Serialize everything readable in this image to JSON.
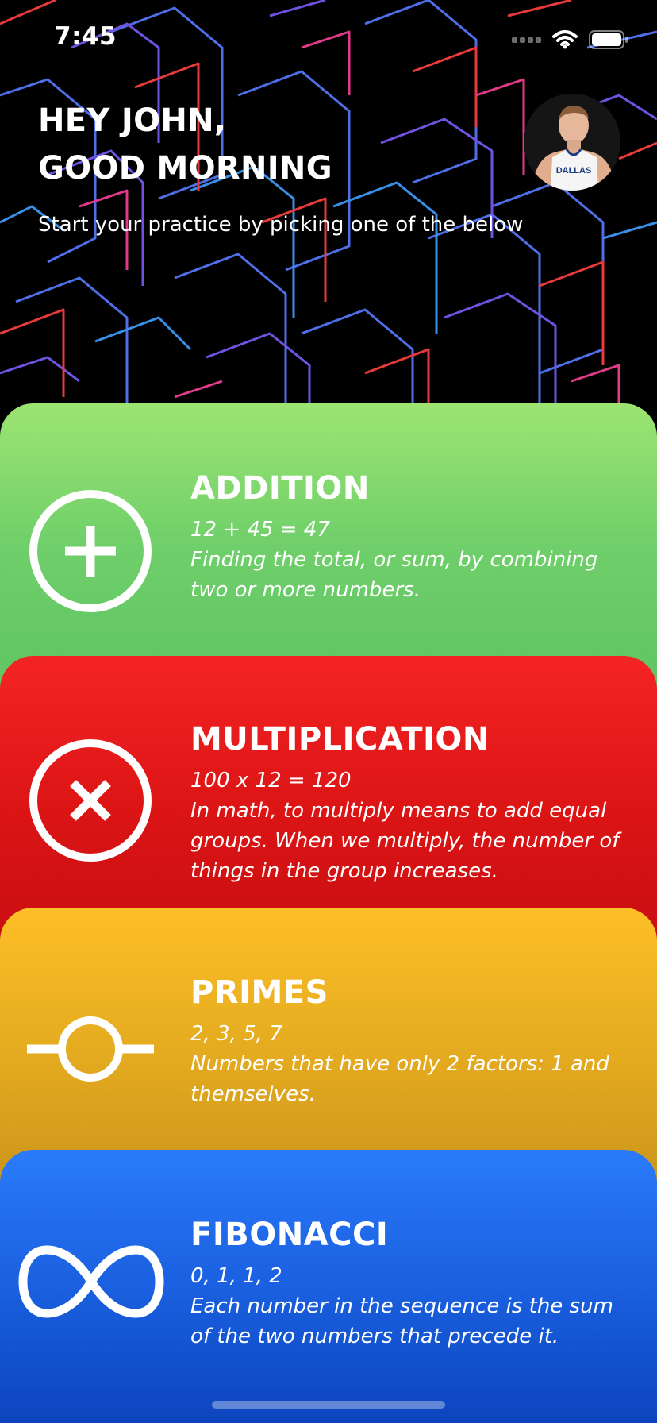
{
  "status_bar": {
    "time": "7:45"
  },
  "header": {
    "greeting_line1": "HEY JOHN,",
    "greeting_line2": "GOOD MORNING",
    "subtitle": "Start your practice by picking one of the below",
    "avatar_jersey_text": "DALLAS"
  },
  "cards": [
    {
      "title": "ADDITION",
      "example": "12 + 45 = 47",
      "description": "Finding the total, or sum, by combining two or more numbers.",
      "icon": "plus-circle-icon",
      "color": "#7fd86b"
    },
    {
      "title": "MULTIPLICATION",
      "example": "100 x 12 = 120",
      "description": "In math, to multiply means to add equal groups. When we multiply, the number of things in the group increases.",
      "icon": "times-circle-icon",
      "color": "#e01a1a"
    },
    {
      "title": "PRIMES",
      "example": "2, 3, 5, 7",
      "description": "Numbers that have only 2 factors: 1 and themselves.",
      "icon": "commit-node-icon",
      "color": "#e4aa20"
    },
    {
      "title": "FIBONACCI",
      "example": "0, 1, 1, 2",
      "description": "Each number in the sequence is the sum of the two numbers that precede it.",
      "icon": "infinity-icon",
      "color": "#1f68e8"
    }
  ],
  "theme": {
    "hero_background": "#000000",
    "text_color": "#ffffff"
  }
}
